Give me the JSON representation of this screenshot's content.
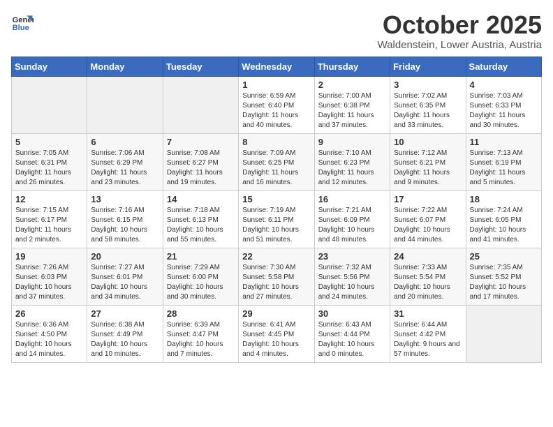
{
  "logo": {
    "line1": "General",
    "line2": "Blue"
  },
  "title": "October 2025",
  "subtitle": "Waldenstein, Lower Austria, Austria",
  "headers": [
    "Sunday",
    "Monday",
    "Tuesday",
    "Wednesday",
    "Thursday",
    "Friday",
    "Saturday"
  ],
  "weeks": [
    [
      {
        "day": "",
        "info": ""
      },
      {
        "day": "",
        "info": ""
      },
      {
        "day": "",
        "info": ""
      },
      {
        "day": "1",
        "info": "Sunrise: 6:59 AM\nSunset: 6:40 PM\nDaylight: 11 hours and 40 minutes."
      },
      {
        "day": "2",
        "info": "Sunrise: 7:00 AM\nSunset: 6:38 PM\nDaylight: 11 hours and 37 minutes."
      },
      {
        "day": "3",
        "info": "Sunrise: 7:02 AM\nSunset: 6:35 PM\nDaylight: 11 hours and 33 minutes."
      },
      {
        "day": "4",
        "info": "Sunrise: 7:03 AM\nSunset: 6:33 PM\nDaylight: 11 hours and 30 minutes."
      }
    ],
    [
      {
        "day": "5",
        "info": "Sunrise: 7:05 AM\nSunset: 6:31 PM\nDaylight: 11 hours and 26 minutes."
      },
      {
        "day": "6",
        "info": "Sunrise: 7:06 AM\nSunset: 6:29 PM\nDaylight: 11 hours and 23 minutes."
      },
      {
        "day": "7",
        "info": "Sunrise: 7:08 AM\nSunset: 6:27 PM\nDaylight: 11 hours and 19 minutes."
      },
      {
        "day": "8",
        "info": "Sunrise: 7:09 AM\nSunset: 6:25 PM\nDaylight: 11 hours and 16 minutes."
      },
      {
        "day": "9",
        "info": "Sunrise: 7:10 AM\nSunset: 6:23 PM\nDaylight: 11 hours and 12 minutes."
      },
      {
        "day": "10",
        "info": "Sunrise: 7:12 AM\nSunset: 6:21 PM\nDaylight: 11 hours and 9 minutes."
      },
      {
        "day": "11",
        "info": "Sunrise: 7:13 AM\nSunset: 6:19 PM\nDaylight: 11 hours and 5 minutes."
      }
    ],
    [
      {
        "day": "12",
        "info": "Sunrise: 7:15 AM\nSunset: 6:17 PM\nDaylight: 11 hours and 2 minutes."
      },
      {
        "day": "13",
        "info": "Sunrise: 7:16 AM\nSunset: 6:15 PM\nDaylight: 10 hours and 58 minutes."
      },
      {
        "day": "14",
        "info": "Sunrise: 7:18 AM\nSunset: 6:13 PM\nDaylight: 10 hours and 55 minutes."
      },
      {
        "day": "15",
        "info": "Sunrise: 7:19 AM\nSunset: 6:11 PM\nDaylight: 10 hours and 51 minutes."
      },
      {
        "day": "16",
        "info": "Sunrise: 7:21 AM\nSunset: 6:09 PM\nDaylight: 10 hours and 48 minutes."
      },
      {
        "day": "17",
        "info": "Sunrise: 7:22 AM\nSunset: 6:07 PM\nDaylight: 10 hours and 44 minutes."
      },
      {
        "day": "18",
        "info": "Sunrise: 7:24 AM\nSunset: 6:05 PM\nDaylight: 10 hours and 41 minutes."
      }
    ],
    [
      {
        "day": "19",
        "info": "Sunrise: 7:26 AM\nSunset: 6:03 PM\nDaylight: 10 hours and 37 minutes."
      },
      {
        "day": "20",
        "info": "Sunrise: 7:27 AM\nSunset: 6:01 PM\nDaylight: 10 hours and 34 minutes."
      },
      {
        "day": "21",
        "info": "Sunrise: 7:29 AM\nSunset: 6:00 PM\nDaylight: 10 hours and 30 minutes."
      },
      {
        "day": "22",
        "info": "Sunrise: 7:30 AM\nSunset: 5:58 PM\nDaylight: 10 hours and 27 minutes."
      },
      {
        "day": "23",
        "info": "Sunrise: 7:32 AM\nSunset: 5:56 PM\nDaylight: 10 hours and 24 minutes."
      },
      {
        "day": "24",
        "info": "Sunrise: 7:33 AM\nSunset: 5:54 PM\nDaylight: 10 hours and 20 minutes."
      },
      {
        "day": "25",
        "info": "Sunrise: 7:35 AM\nSunset: 5:52 PM\nDaylight: 10 hours and 17 minutes."
      }
    ],
    [
      {
        "day": "26",
        "info": "Sunrise: 6:36 AM\nSunset: 4:50 PM\nDaylight: 10 hours and 14 minutes."
      },
      {
        "day": "27",
        "info": "Sunrise: 6:38 AM\nSunset: 4:49 PM\nDaylight: 10 hours and 10 minutes."
      },
      {
        "day": "28",
        "info": "Sunrise: 6:39 AM\nSunset: 4:47 PM\nDaylight: 10 hours and 7 minutes."
      },
      {
        "day": "29",
        "info": "Sunrise: 6:41 AM\nSunset: 4:45 PM\nDaylight: 10 hours and 4 minutes."
      },
      {
        "day": "30",
        "info": "Sunrise: 6:43 AM\nSunset: 4:44 PM\nDaylight: 10 hours and 0 minutes."
      },
      {
        "day": "31",
        "info": "Sunrise: 6:44 AM\nSunset: 4:42 PM\nDaylight: 9 hours and 57 minutes."
      },
      {
        "day": "",
        "info": ""
      }
    ]
  ]
}
